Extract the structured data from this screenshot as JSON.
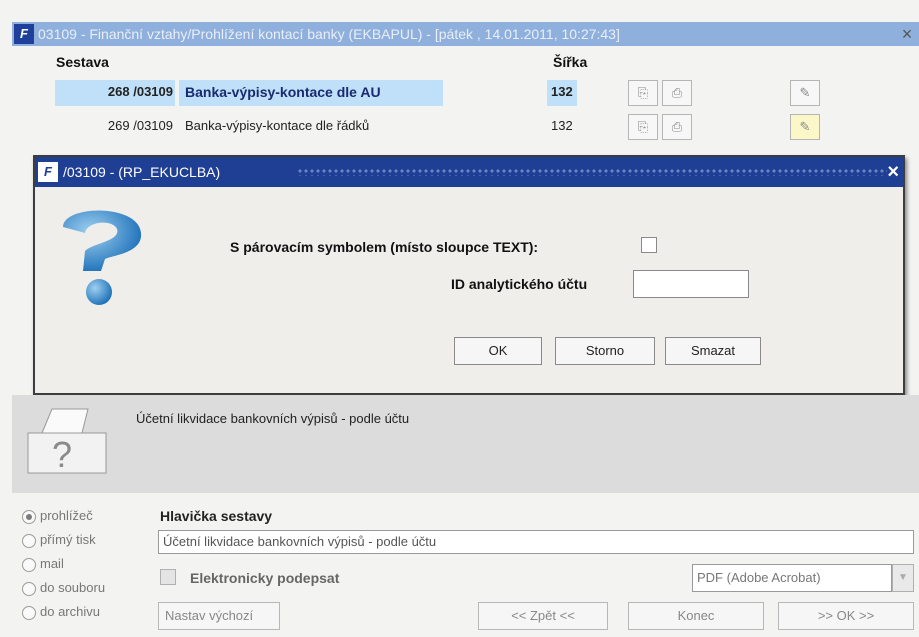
{
  "main_window": {
    "logo": "F",
    "title": "03109 - Finanční vztahy/Prohlížení kontací banky (EKBAPUL) - [pátek , 14.01.2011, 10:27:43]",
    "close": "×"
  },
  "table": {
    "headers": {
      "sestava": "Sestava",
      "sirka": "Šířka"
    },
    "rows": [
      {
        "num": "268 /03109",
        "name": "Banka-výpisy-kontace dle AU",
        "width": "132"
      },
      {
        "num": "269 /03109",
        "name": "Banka-výpisy-kontace dle řádků",
        "width": "132"
      }
    ]
  },
  "dialog": {
    "logo": "F",
    "title": "/03109 - (RP_EKUCLBA)",
    "close": "×",
    "label_parovaci": "S párovacím symbolem (místo sloupce TEXT):",
    "label_id_uctu": "ID analytického účtu",
    "id_uctu_value": "",
    "buttons": {
      "ok": "OK",
      "storno": "Storno",
      "smazat": "Smazat"
    }
  },
  "report_description": "Účetní likvidace bankovních výpisů - podle účtu",
  "output": {
    "options": [
      "prohlížeč",
      "přímý tisk",
      "mail",
      "do souboru",
      "do archivu"
    ],
    "selected": "prohlížeč"
  },
  "header_section": {
    "label": "Hlavička sestavy",
    "value": "Účetní likvidace bankovních výpisů - podle účtu",
    "sign_label": "Elektronicky podepsat",
    "format_value": "PDF (Adobe Acrobat)"
  },
  "bottom_buttons": {
    "default": "Nastav výchozí",
    "back": "<< Zpět <<",
    "end": "Konec",
    "ok": ">> OK >>"
  },
  "colors": {
    "dialog_title_bg": "#1f3f95",
    "selected_row": "#bfe0f8",
    "main_title_bg": "#8fb0dc"
  }
}
